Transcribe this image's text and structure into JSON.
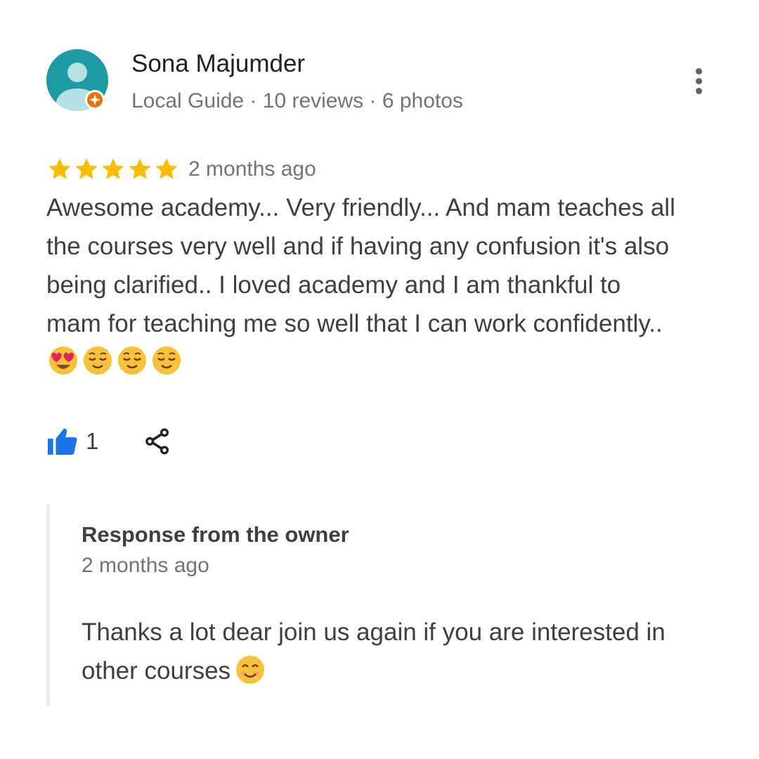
{
  "reviewer": {
    "name": "Sona Majumder",
    "meta": "Local Guide · 10 reviews · 6 photos",
    "avatar_icon": "person-avatar-icon",
    "badge_icon": "local-guide-badge-icon"
  },
  "more_options_icon": "more-vert-icon",
  "review": {
    "rating": 5,
    "rating_max": 5,
    "date": "2 months ago",
    "text": "Awesome academy... Very friendly... And mam teaches all the courses very well and if having any confusion it's also being clarified.. I loved academy and I am thankful to mam for teaching me so well that I can work confidently..",
    "emojis": [
      "😍",
      "😌",
      "😌",
      "😌"
    ]
  },
  "actions": {
    "like_count": "1",
    "like_icon": "thumbs-up-icon",
    "share_icon": "share-icon"
  },
  "owner_response": {
    "title": "Response from the owner",
    "date": "2 months ago",
    "text": "Thanks a lot dear join us again if you are interested in other courses",
    "emoji": "😊"
  },
  "colors": {
    "star": "#fbbc04",
    "accent_blue": "#1a73e8",
    "avatar_bg": "#1e9aa5",
    "badge_orange": "#e8710a"
  }
}
